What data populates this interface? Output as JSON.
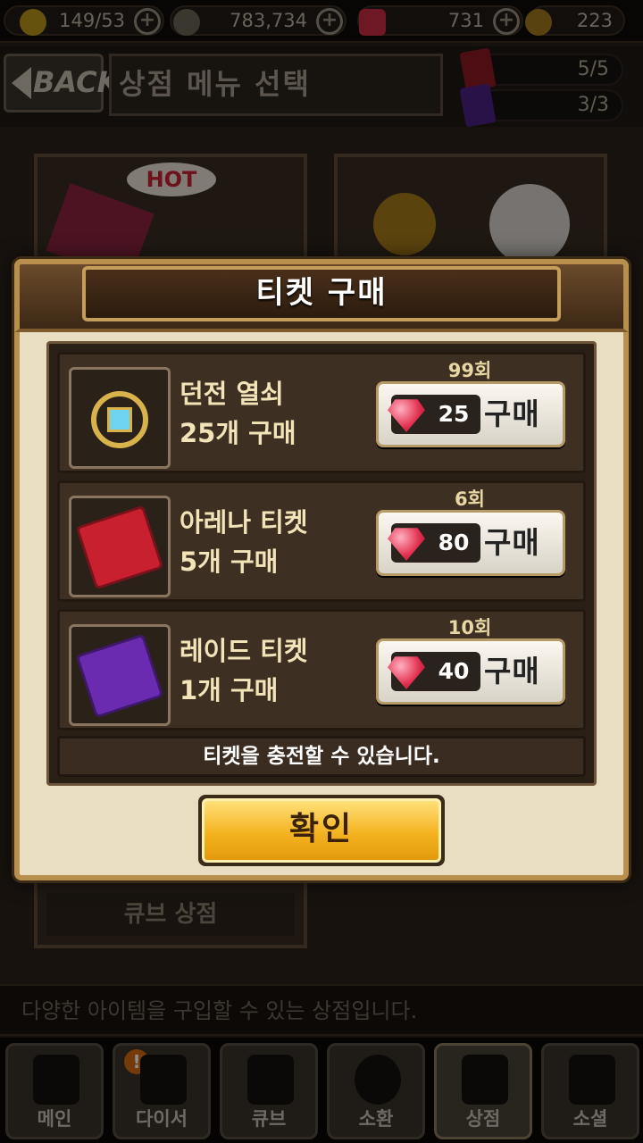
{
  "topbar": {
    "stamina": "149/53",
    "gold": "783,734",
    "gems": "731",
    "medals": "223"
  },
  "header": {
    "back_label": "BACK",
    "title": "상점 메뉴 선택",
    "tickets": [
      "5/5",
      "3/3"
    ]
  },
  "background": {
    "hot_badge": "HOT",
    "cube_shop_label": "큐브 상점",
    "info_text": "다양한 아이템을 구입할 수 있는 상점입니다."
  },
  "tabs": [
    {
      "label": "메인"
    },
    {
      "label": "다이서"
    },
    {
      "label": "큐브"
    },
    {
      "label": "소환"
    },
    {
      "label": "상점"
    },
    {
      "label": "소셜"
    }
  ],
  "dialog": {
    "title": "티켓 구매",
    "items": [
      {
        "name_line1": "던전 열쇠",
        "name_line2": "25개 구매",
        "count": "99회",
        "price": "25",
        "buy_label": "구매",
        "icon": "dungeon-key-icon"
      },
      {
        "name_line1": "아레나 티켓",
        "name_line2": "5개 구매",
        "count": "6회",
        "price": "80",
        "buy_label": "구매",
        "icon": "arena-ticket-icon"
      },
      {
        "name_line1": "레이드 티켓",
        "name_line2": "1개 구매",
        "count": "10회",
        "price": "40",
        "buy_label": "구매",
        "icon": "raid-ticket-icon"
      }
    ],
    "notice": "티켓을 충전할 수 있습니다.",
    "confirm_label": "확인"
  },
  "colors": {
    "arena_ticket": "#c8202e",
    "raid_ticket": "#6a2bb0",
    "gem": "#e2304f",
    "confirm": "#f4b320"
  }
}
